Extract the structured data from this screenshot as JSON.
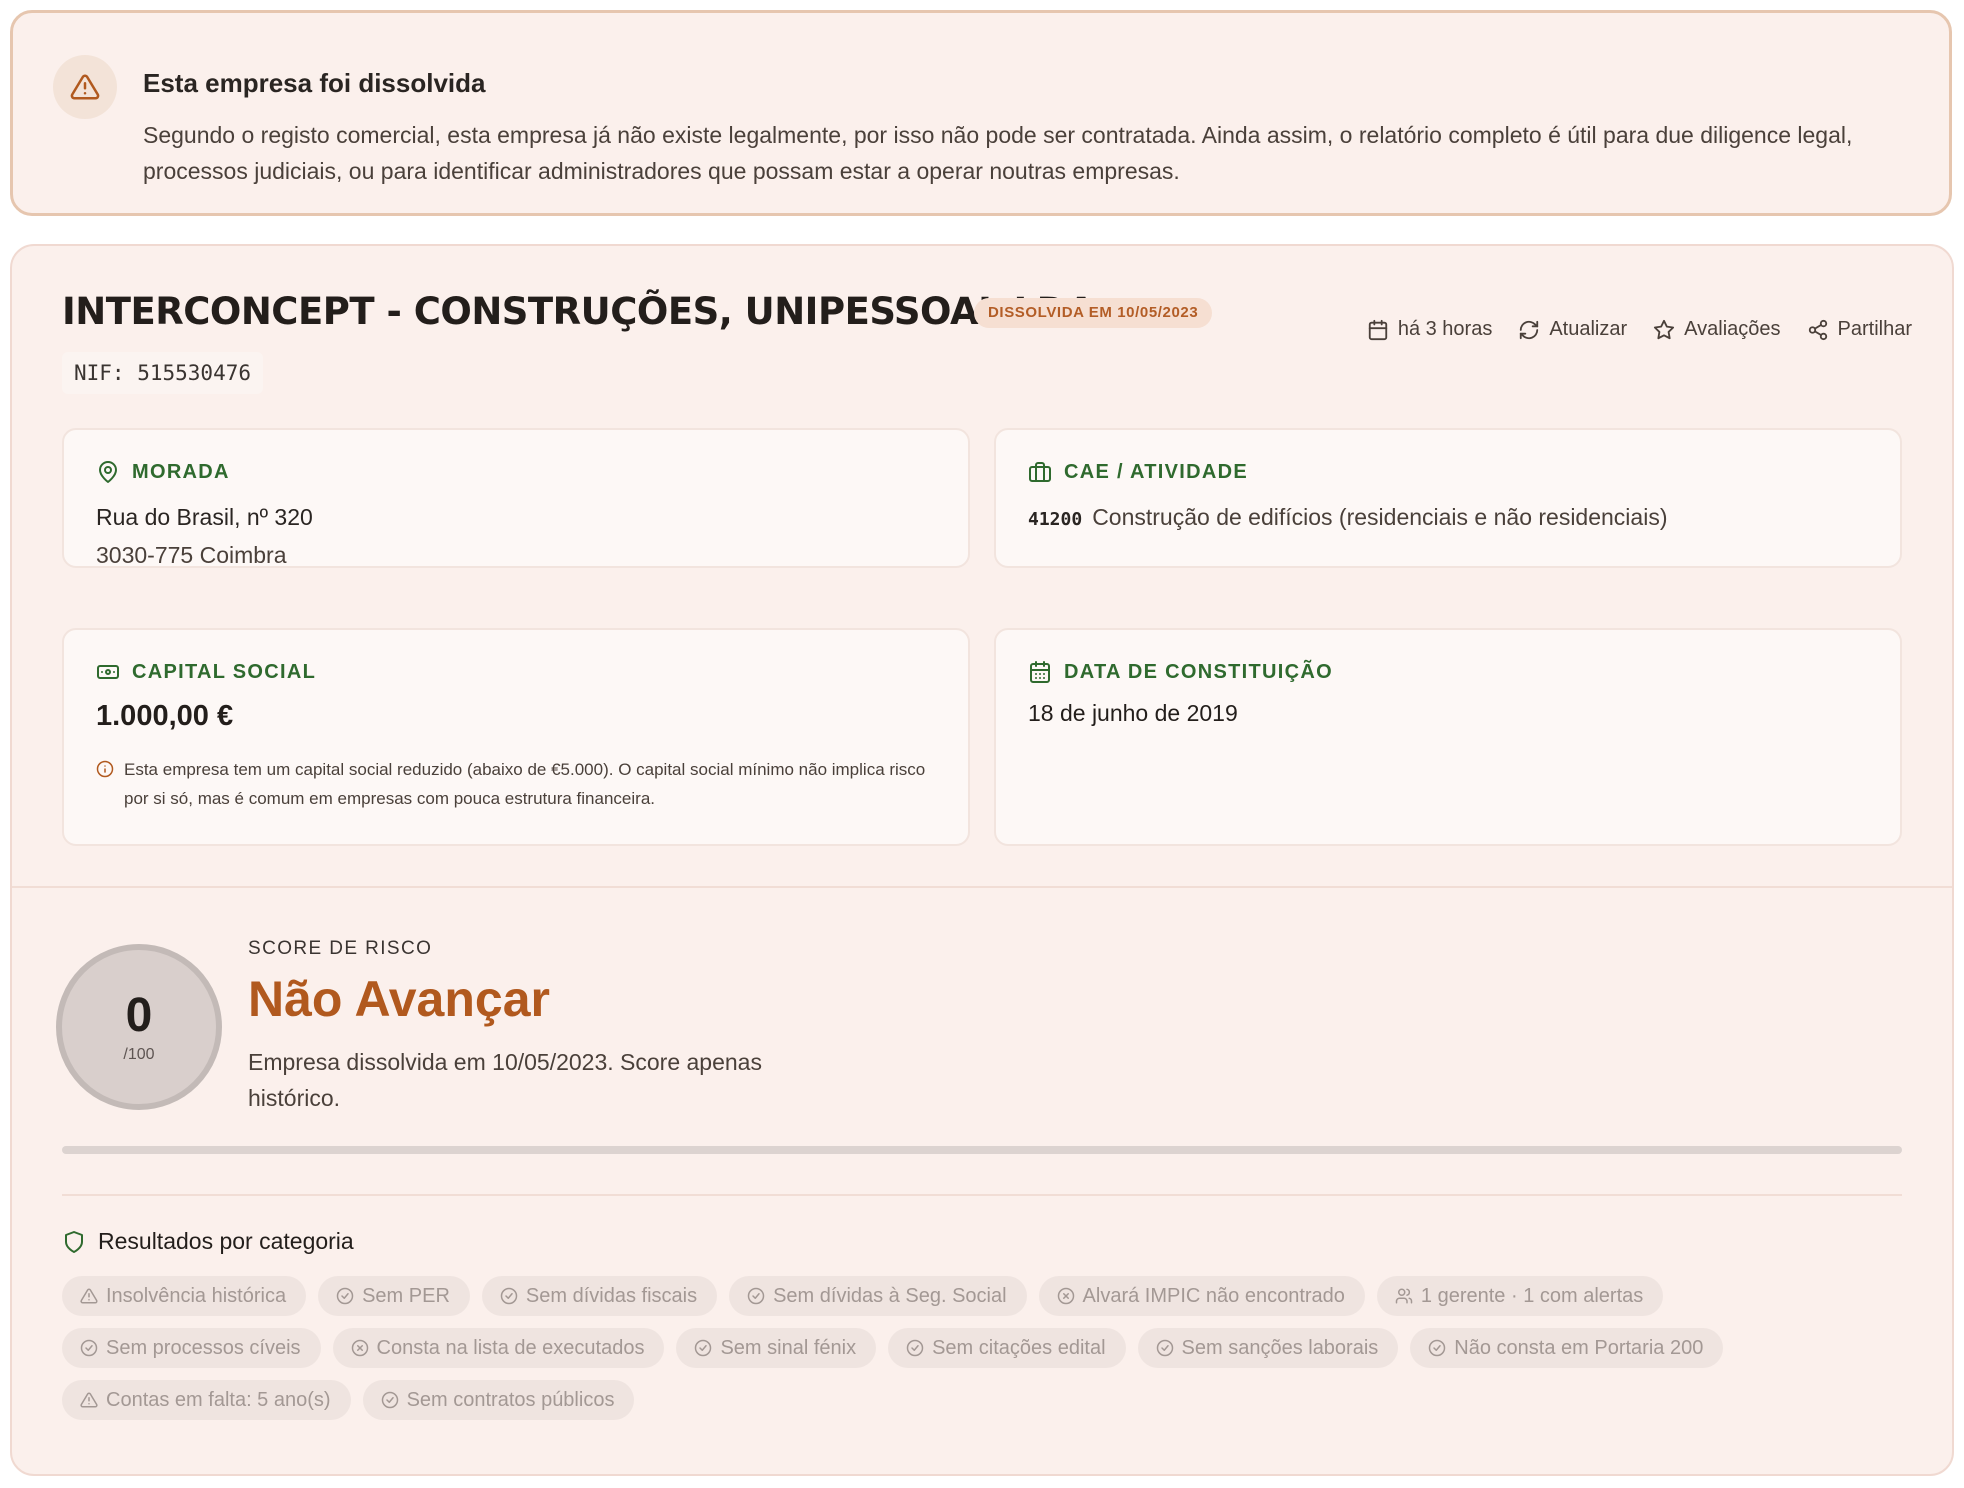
{
  "banner": {
    "title": "Esta empresa foi dissolvida",
    "text": "Segundo o registo comercial, esta empresa já não existe legalmente, por isso não pode ser contratada. Ainda assim, o relatório completo é útil para due diligence legal, processos judiciais, ou para identificar administradores que possam estar a operar noutras empresas."
  },
  "company": {
    "name": "INTERCONCEPT - CONSTRUÇÕES, UNIPESSOAL LDA",
    "status_badge": "DISSOLVIDA EM 10/05/2023",
    "nif": "NIF: 515530476"
  },
  "actions": {
    "updated": "há 3 horas",
    "refresh": "Atualizar",
    "reviews": "Avaliações",
    "share": "Partilhar"
  },
  "address": {
    "heading": "MORADA",
    "line1": "Rua do Brasil, nº 320",
    "line2": "3030-775 Coimbra"
  },
  "activity": {
    "heading": "CAE / ATIVIDADE",
    "code": "41200",
    "description": "Construção de edifícios (residenciais e não residenciais)"
  },
  "capital": {
    "heading": "CAPITAL SOCIAL",
    "value": "1.000,00 €",
    "note": "Esta empresa tem um capital social reduzido (abaixo de €5.000). O capital social mínimo não implica risco por si só, mas é comum em empresas com pouca estrutura financeira."
  },
  "constitution": {
    "heading": "DATA DE CONSTITUIÇÃO",
    "date": "18 de junho de 2019"
  },
  "risk": {
    "label": "SCORE DE RISCO",
    "score": "0",
    "max": "/100",
    "score_fraction": 0,
    "verdict": "Não Avançar",
    "description": "Empresa dissolvida em 10/05/2023. Score apenas histórico."
  },
  "categories": {
    "title": "Resultados por categoria",
    "chips": [
      {
        "icon": "warning-icon",
        "label": "Insolvência histórica"
      },
      {
        "icon": "check-circle-icon",
        "label": "Sem PER"
      },
      {
        "icon": "check-circle-icon",
        "label": "Sem dívidas fiscais"
      },
      {
        "icon": "check-circle-icon",
        "label": "Sem dívidas à Seg. Social"
      },
      {
        "icon": "x-circle-icon",
        "label": "Alvará IMPIC não encontrado"
      },
      {
        "icon": "users-icon",
        "label": "1 gerente · 1 com alertas"
      },
      {
        "icon": "check-circle-icon",
        "label": "Sem processos cíveis"
      },
      {
        "icon": "x-circle-icon",
        "label": "Consta na lista de executados"
      },
      {
        "icon": "check-circle-icon",
        "label": "Sem sinal fénix"
      },
      {
        "icon": "check-circle-icon",
        "label": "Sem citações edital"
      },
      {
        "icon": "check-circle-icon",
        "label": "Sem sanções laborais"
      },
      {
        "icon": "check-circle-icon",
        "label": "Não consta em Portaria 200"
      },
      {
        "icon": "warning-icon",
        "label": "Contas em falta: 5 ano(s)"
      },
      {
        "icon": "check-circle-icon",
        "label": "Sem contratos públicos"
      }
    ]
  },
  "colors": {
    "accent_green": "#2f6a2e",
    "verdict_orange": "#b1591e",
    "badge_text": "#b35d26",
    "card_bg": "#fbf0ec"
  }
}
